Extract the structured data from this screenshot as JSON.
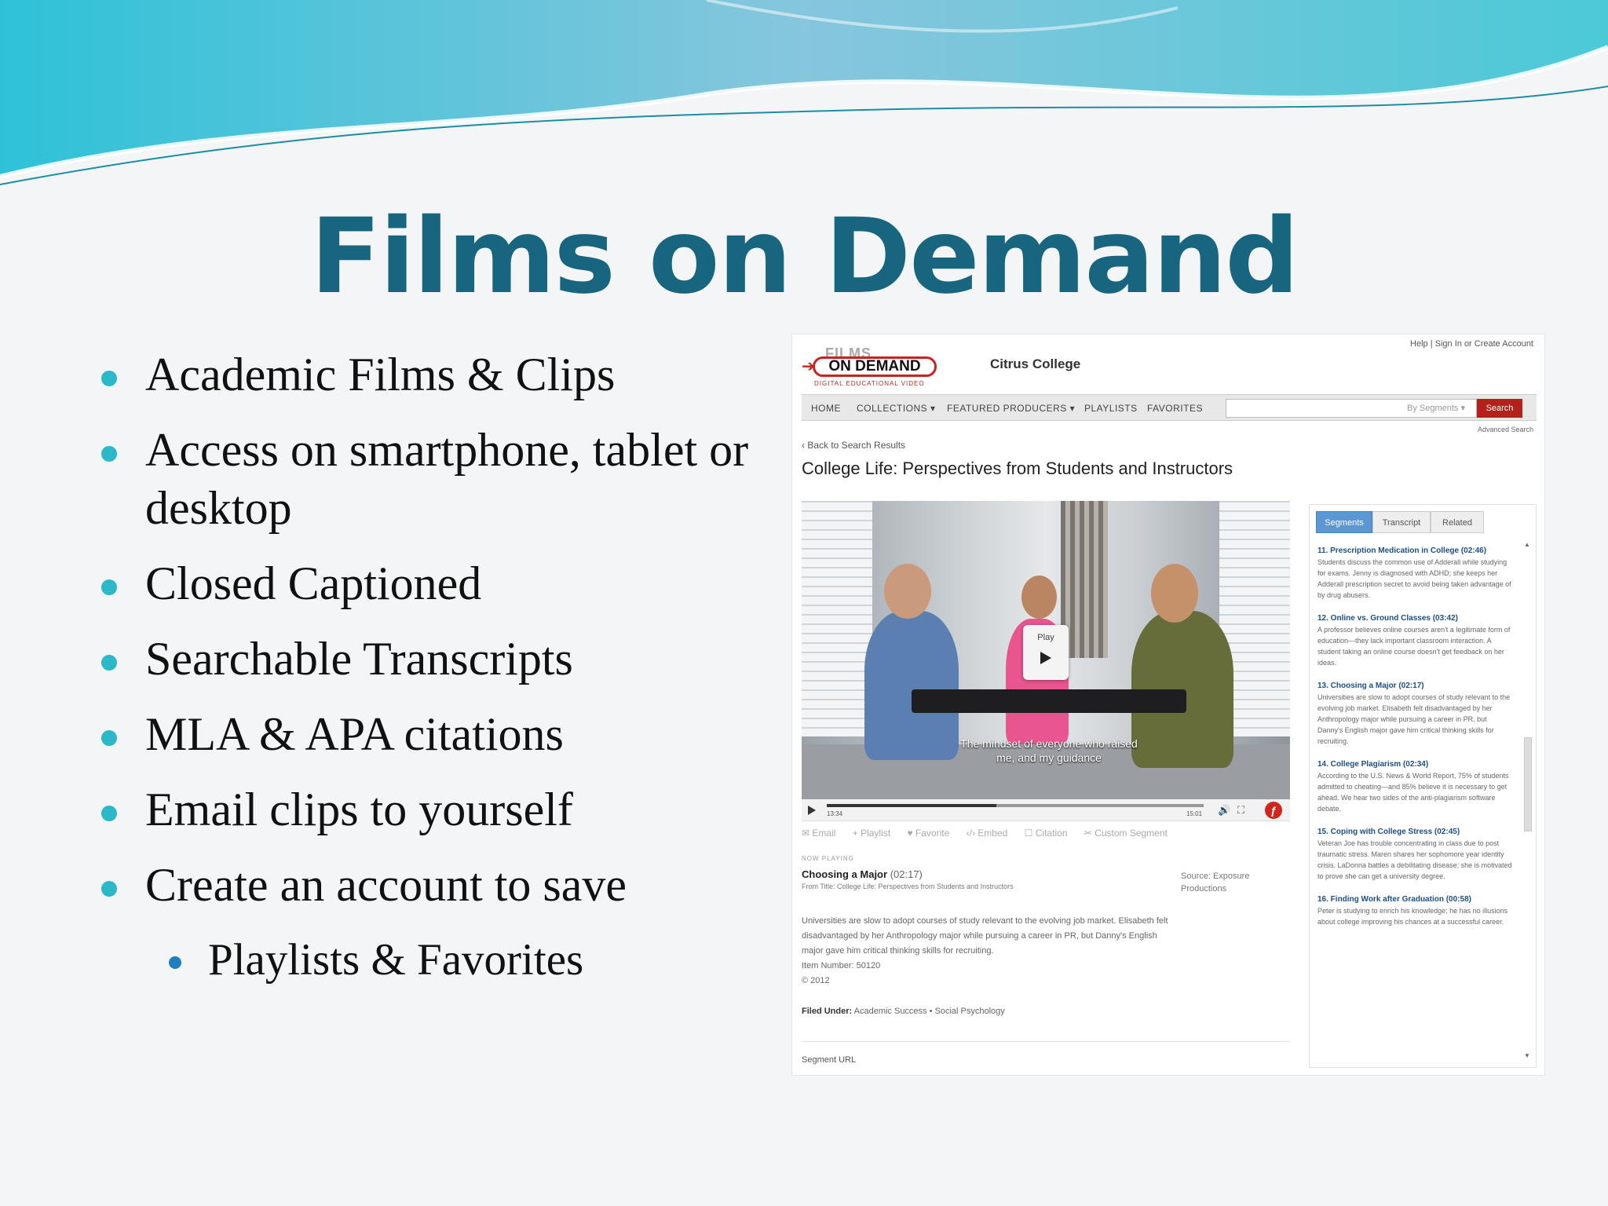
{
  "slide": {
    "title": "Films on Demand",
    "bullets": [
      "Academic Films & Clips",
      "Access on smartphone, tablet or desktop",
      "Closed Captioned",
      "Searchable Transcripts",
      "MLA & APA citations",
      "Email clips to yourself",
      "Create an account to save"
    ],
    "sub_bullets": [
      "Playlists & Favorites"
    ]
  },
  "site": {
    "logo_top": "FILMS",
    "logo_main": "ON DEMAND",
    "logo_tagline": "DIGITAL EDUCATIONAL VIDEO",
    "college": "Citrus College",
    "top_links": "Help | Sign In  or  Create Account",
    "nav": [
      "HOME",
      "COLLECTIONS ▾",
      "FEATURED PRODUCERS ▾",
      "PLAYLISTS",
      "FAVORITES"
    ],
    "search_hint": "By Segments  ▾",
    "search_button": "Search",
    "advanced_search": "Advanced Search",
    "back_link": "‹ Back to Search Results",
    "video_title": "College Life: Perspectives from Students and Instructors"
  },
  "player": {
    "play_label": "Play",
    "caption": "The mindset of everyone who raised me, and my guidance",
    "time_elapsed": "13:34",
    "time_total": "15:01",
    "progress": 0.45
  },
  "actions": [
    "✉ Email",
    "+ Playlist",
    "♥ Favorite",
    "‹/› Embed",
    "☐ Citation",
    "✂ Custom Segment"
  ],
  "now_playing": {
    "label": "NOW PLAYING",
    "title": "Choosing a Major",
    "duration": "(02:17)",
    "from": "From Title: College Life: Perspectives from Students and Instructors",
    "source": "Source: Exposure Productions",
    "description": "Universities are slow to adopt courses of study relevant to the evolving job market. Elisabeth felt disadvantaged by her Anthropology major while pursuing a career in PR, but Danny's English major gave him critical thinking skills for recruiting.",
    "item_number": "Item Number: 50120",
    "copyright": "© 2012",
    "filed_under_label": "Filed Under:",
    "filed_under": "Academic Success  •  Social Psychology",
    "segment_url": "Segment URL"
  },
  "panel": {
    "tabs": [
      "Segments",
      "Transcript",
      "Related"
    ],
    "segments": [
      {
        "title": "11. Prescription Medication in College (02:46)",
        "desc": "Students discuss the common use of Adderall while studying for exams. Jenny is diagnosed with ADHD; she keeps her Adderall prescription secret to avoid being taken advantage of by drug abusers."
      },
      {
        "title": "12. Online vs. Ground Classes (03:42)",
        "desc": "A professor believes online courses aren't a legitimate form of education—they lack important classroom interaction. A student taking an online course doesn't get feedback on her ideas."
      },
      {
        "title": "13. Choosing a Major (02:17)",
        "desc": "Universities are slow to adopt courses of study relevant to the evolving job market. Elisabeth felt disadvantaged by her Anthropology major while pursuing a career in PR, but Danny's English major gave him critical thinking skills for recruiting."
      },
      {
        "title": "14. College Plagiarism (02:34)",
        "desc": "According to the U.S. News & World Report, 75% of students admitted to cheating—and 85% believe it is necessary to get ahead. We hear two sides of the anti-plagiarism software debate."
      },
      {
        "title": "15. Coping with College Stress (02:45)",
        "desc": "Veteran Joe has trouble concentrating in class due to post traumatic stress. Maren shares her sophomore year identity crisis. LaDonna battles a debilitating disease; she is motivated to prove she can get a university degree."
      },
      {
        "title": "16. Finding Work after Graduation (00:58)",
        "desc": "Peter is studying to enrich his knowledge; he has no illusions about college improving his chances at a successful career."
      }
    ]
  }
}
